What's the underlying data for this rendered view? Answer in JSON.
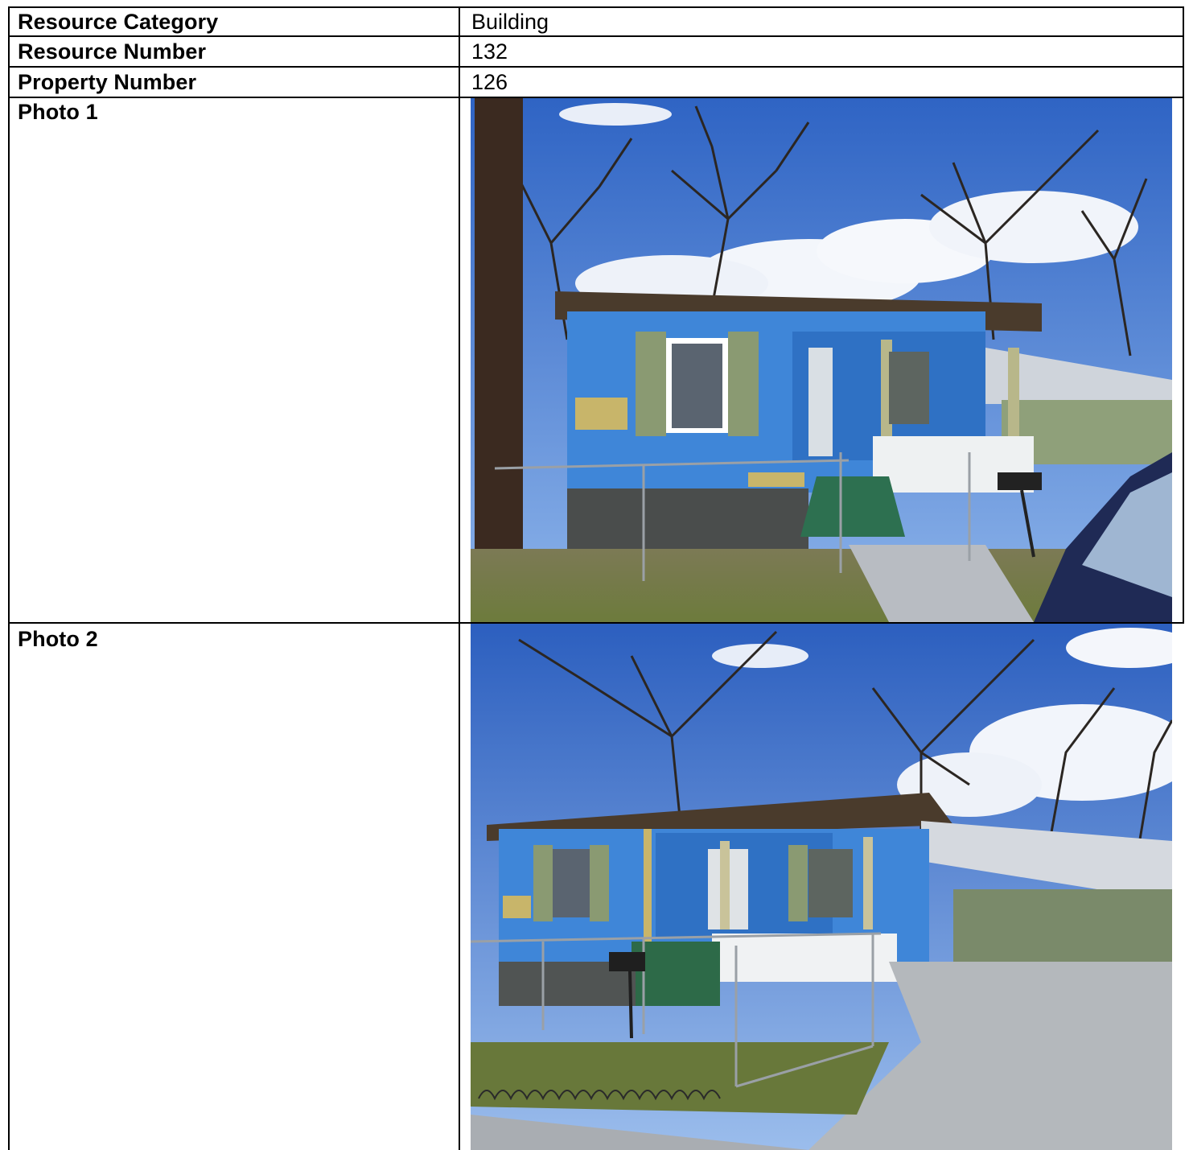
{
  "rows": [
    {
      "label": "Resource Category",
      "value": "Building"
    },
    {
      "label": "Resource Number",
      "value": "132"
    },
    {
      "label": "Property Number",
      "value": "126"
    }
  ],
  "photos": [
    {
      "label": "Photo 1",
      "subject": "house-photo"
    },
    {
      "label": "Photo 2",
      "subject": "house-photo"
    }
  ],
  "colors": {
    "sky": "#4a7fd3",
    "house_siding": "#3f86d8",
    "shutters": "#8a9a72",
    "trim": "#c8b56a",
    "grass": "#6c7a3e",
    "border": "#000000"
  }
}
